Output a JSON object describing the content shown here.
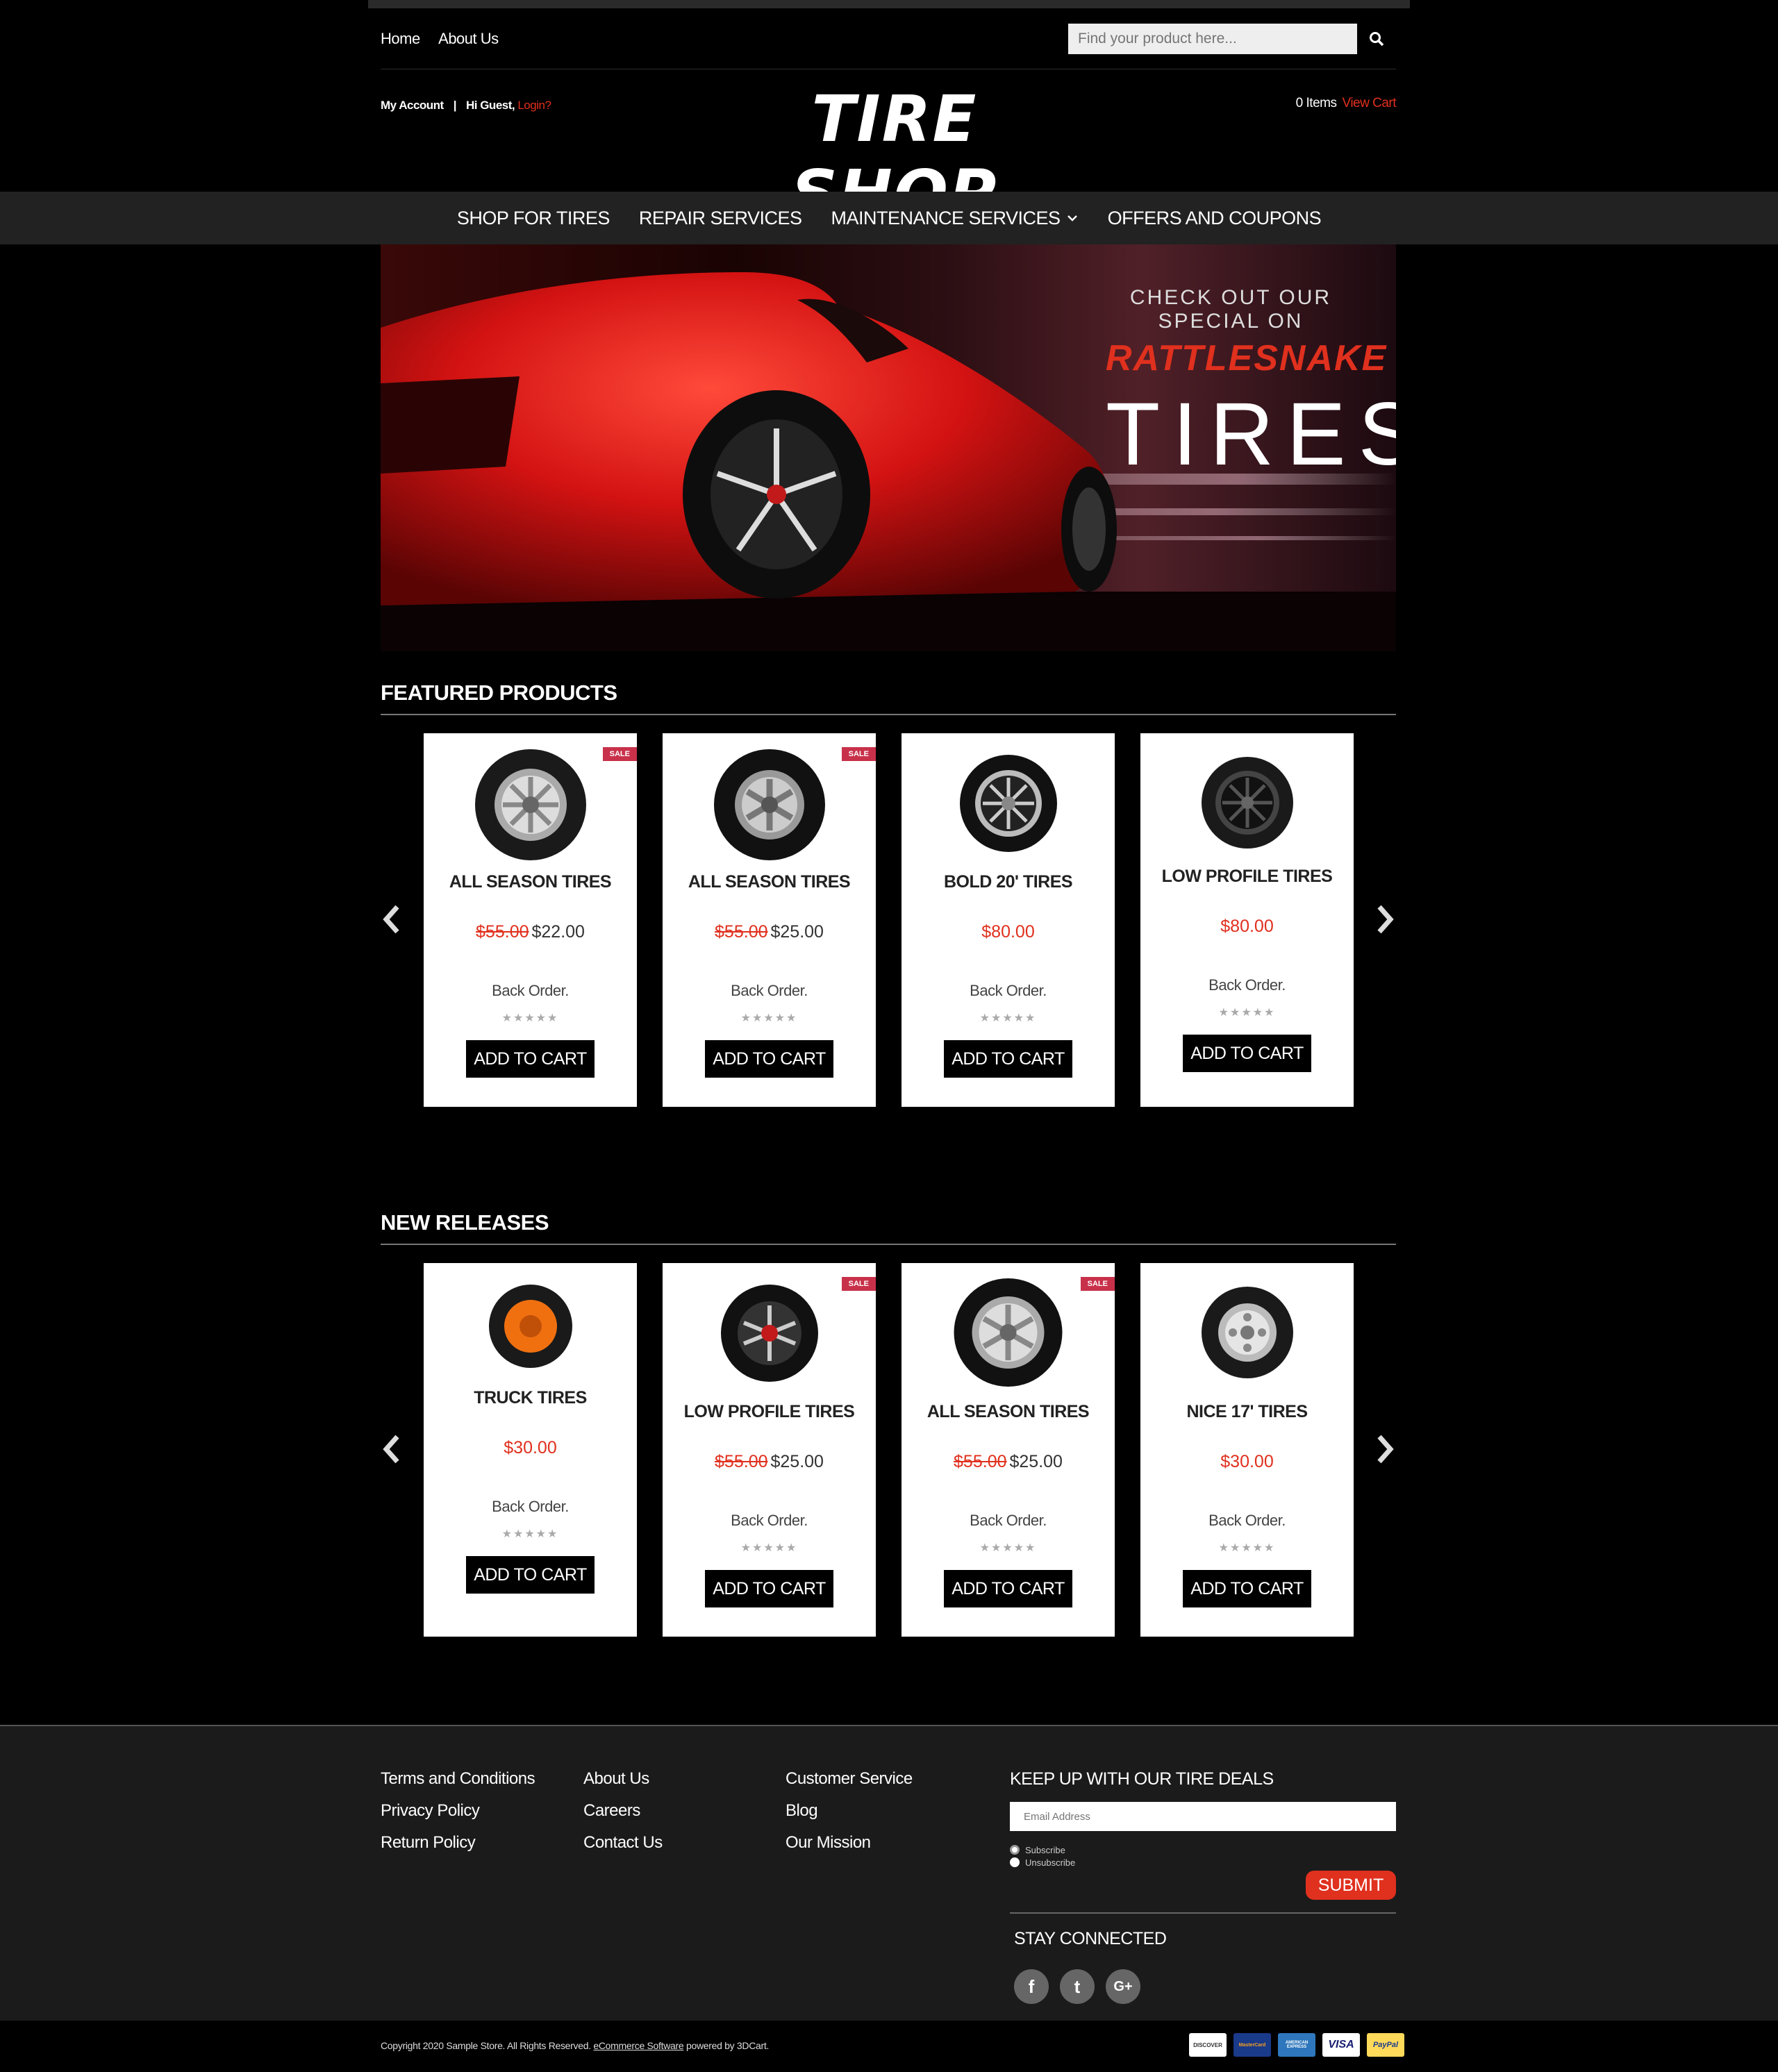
{
  "topbar": {
    "links": [
      "Home",
      "About Us"
    ],
    "search_placeholder": "Find your product here...",
    "search_icon": "search-icon"
  },
  "header": {
    "my_account": "My Account",
    "separator": "|",
    "greeting": "Hi Guest,",
    "login": "Login?",
    "logo": "TIRE SHOP",
    "cart_items": "0 Items",
    "view_cart": "View Cart"
  },
  "nav": {
    "items": [
      "SHOP FOR TIRES",
      "REPAIR SERVICES",
      "MAINTENANCE SERVICES",
      "OFFERS AND COUPONS"
    ]
  },
  "banner": {
    "line1": "CHECK OUT OUR SPECIAL ON",
    "line2": "RATTLESNAKE",
    "line3": "TIRES"
  },
  "featured": {
    "title": "FEATURED PRODUCTS",
    "products": [
      {
        "name": "ALL SEASON TIRES",
        "old_price": "$55.00",
        "price": "$22.00",
        "stock": "Back Order.",
        "sale": "SALE",
        "button": "ADD TO CART"
      },
      {
        "name": "ALL SEASON TIRES",
        "old_price": "$55.00",
        "price": "$25.00",
        "stock": "Back Order.",
        "sale": "SALE",
        "button": "ADD TO CART"
      },
      {
        "name": "BOLD 20' TIRES",
        "price": "$80.00",
        "stock": "Back Order.",
        "button": "ADD TO CART"
      },
      {
        "name": "LOW PROFILE TIRES",
        "price": "$80.00",
        "stock": "Back Order.",
        "button": "ADD TO CART"
      }
    ]
  },
  "new_releases": {
    "title": "NEW RELEASES",
    "products": [
      {
        "name": "TRUCK TIRES",
        "price": "$30.00",
        "stock": "Back Order.",
        "button": "ADD TO CART"
      },
      {
        "name": "LOW PROFILE TIRES",
        "old_price": "$55.00",
        "price": "$25.00",
        "stock": "Back Order.",
        "sale": "SALE",
        "button": "ADD TO CART"
      },
      {
        "name": "ALL SEASON TIRES",
        "old_price": "$55.00",
        "price": "$25.00",
        "stock": "Back Order.",
        "sale": "SALE",
        "button": "ADD TO CART"
      },
      {
        "name": "NICE 17' TIRES",
        "price": "$30.00",
        "stock": "Back Order.",
        "button": "ADD TO CART"
      }
    ]
  },
  "stars": "★★★★★",
  "footer": {
    "col1": [
      "Terms and Conditions",
      "Privacy Policy",
      "Return Policy"
    ],
    "col2": [
      "About Us",
      "Careers",
      "Contact Us"
    ],
    "col3": [
      "Customer Service",
      "Blog",
      "Our Mission"
    ],
    "newsletter_title": "KEEP UP WITH OUR TIRE DEALS",
    "email_placeholder": "Email Address",
    "subscribe": "Subscribe",
    "unsubscribe": "Unsubscribe",
    "submit": "SUBMIT",
    "stay_connected": "STAY CONNECTED",
    "social": [
      "f",
      "t",
      "G+"
    ]
  },
  "bottom": {
    "copyright_pre": "Copyright 2020 Sample Store. All Rights Reserved.",
    "copyright_link": "eCommerce Software",
    "copyright_post": "powered by 3DCart.",
    "payments": [
      "DISCOVER",
      "MasterCard",
      "AMERICAN EXPRESS",
      "VISA",
      "PayPal"
    ]
  },
  "colors": {
    "accent": "#e0301e",
    "sale_badge": "#c8314a",
    "background": "#000000",
    "nav": "#222222"
  }
}
